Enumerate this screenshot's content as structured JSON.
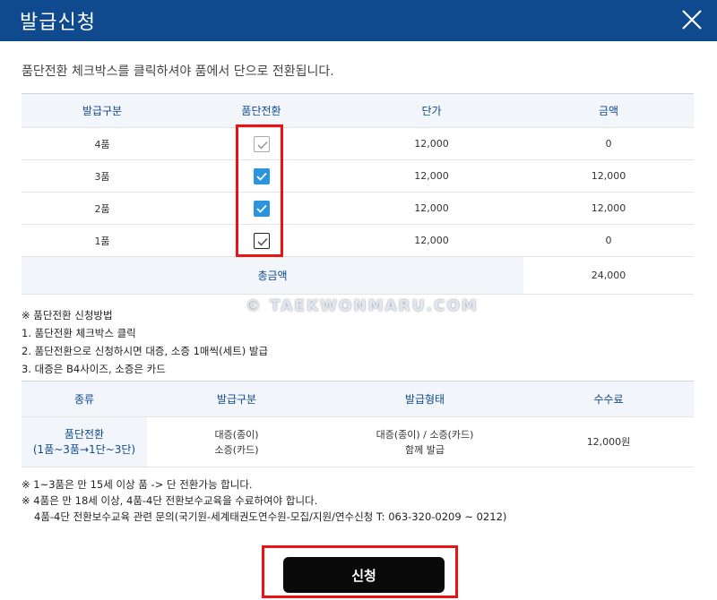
{
  "header": {
    "title": "발급신청"
  },
  "instruction": "품단전환 체크박스를 클릭하셔야 품에서 단으로 전환됩니다.",
  "table1": {
    "headers": [
      "발급구분",
      "품단전환",
      "단가",
      "금액"
    ],
    "rows": [
      {
        "grade": "4품",
        "checked": false,
        "unit_price": "12,000",
        "amount": "0"
      },
      {
        "grade": "3품",
        "checked": true,
        "unit_price": "12,000",
        "amount": "12,000"
      },
      {
        "grade": "2품",
        "checked": true,
        "unit_price": "12,000",
        "amount": "12,000"
      },
      {
        "grade": "1품",
        "checked": false,
        "unit_price": "12,000",
        "amount": "0"
      }
    ],
    "total_label": "총금액",
    "total_value": "24,000"
  },
  "watermark": "© TAEKWONMARU.COM",
  "notes1": [
    "※ 품단전환 신청방법",
    "1. 품단전환 체크박스 클릭",
    "2. 품단전환으로 신청하시면 대증, 소증 1매씩(세트) 발급",
    "3. 대증은 B4사이즈, 소증은 카드"
  ],
  "table2": {
    "headers": [
      "종류",
      "발급구분",
      "발급형태",
      "수수료"
    ],
    "kind_line1": "품단전환",
    "kind_line2": "(1품~3품→1단~3단)",
    "category_line1": "대증(종이)",
    "category_line2": "소증(카드)",
    "form_line1": "대증(종이) / 소증(카드)",
    "form_line2": "함께 발급",
    "fee": "12,000원"
  },
  "notes2": [
    "※ 1~3품은 만 15세 이상 품 -> 단 전환가능 합니다.",
    "※ 4품은 만 18세 이상, 4품-4단 전환보수교육을 수료하여야 합니다.",
    "4품-4단 전환보수교육 관련 문의(국기원-세계태권도연수원-모집/지원/연수신청 T: 063-320-0209 ~ 0212)"
  ],
  "apply_button": "신청",
  "colors": {
    "header_bg": "#0f4a8f",
    "accent": "#2b94de",
    "highlight": "#e11111",
    "button_bg": "#0a0a0a"
  },
  "icons": {
    "close": "close-icon",
    "check": "check-icon"
  }
}
